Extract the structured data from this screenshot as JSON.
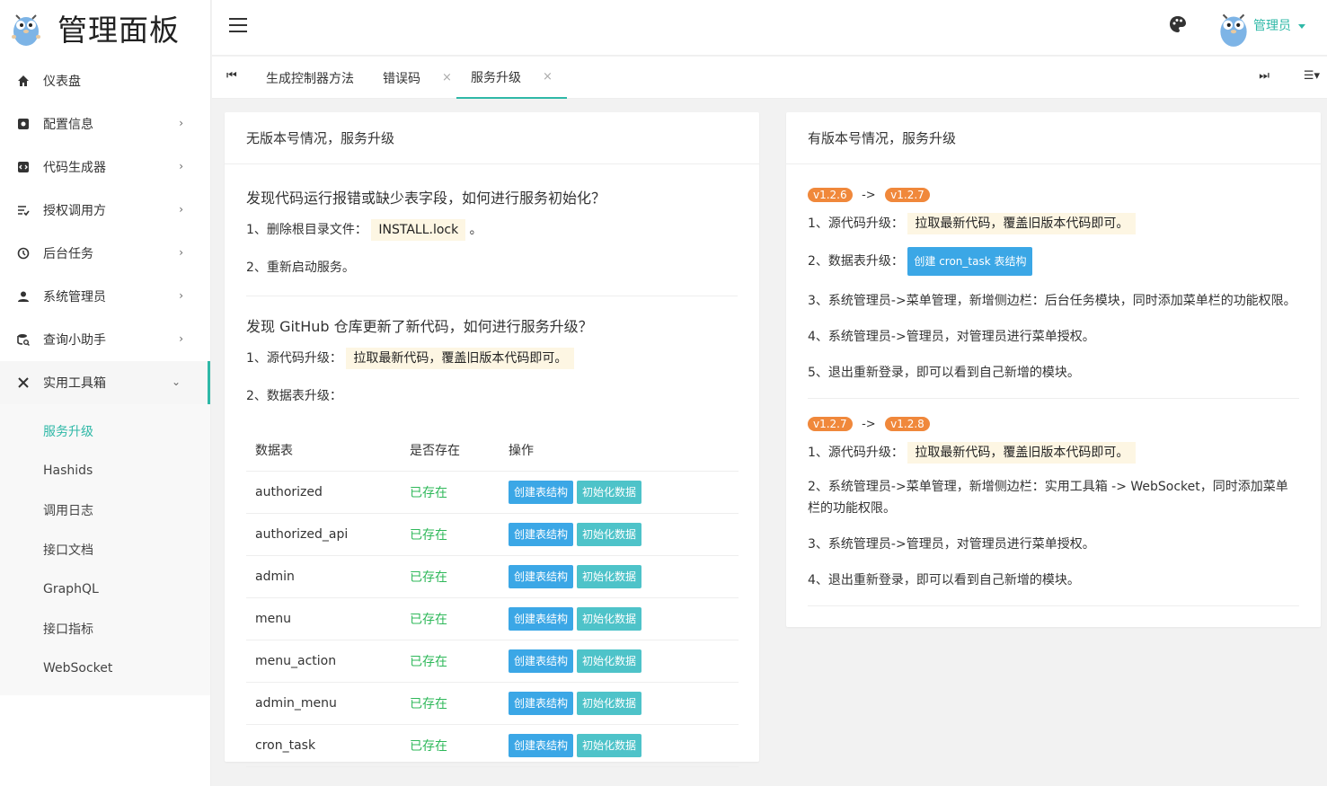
{
  "brand": {
    "title": "管理面板",
    "logo_icon": "gopher-logo-icon"
  },
  "sidebar": {
    "items": [
      {
        "label": "仪表盘",
        "icon": "home-icon"
      },
      {
        "label": "配置信息",
        "icon": "config-icon"
      },
      {
        "label": "代码生成器",
        "icon": "code-icon"
      },
      {
        "label": "授权调用方",
        "icon": "auth-icon"
      },
      {
        "label": "后台任务",
        "icon": "clock-icon"
      },
      {
        "label": "系统管理员",
        "icon": "user-icon"
      },
      {
        "label": "查询小助手",
        "icon": "database-search-icon"
      },
      {
        "label": "实用工具箱",
        "icon": "tools-icon"
      }
    ],
    "sub_items": [
      "服务升级",
      "Hashids",
      "调用日志",
      "接口文档",
      "GraphQL",
      "接口指标",
      "WebSocket"
    ]
  },
  "header": {
    "user": "管理员"
  },
  "tabs": {
    "items": [
      {
        "label": "生成控制器方法"
      },
      {
        "label": "错误码"
      },
      {
        "label": "服务升级"
      }
    ],
    "close": "×"
  },
  "left_card": {
    "title": "无版本号情况，服务升级",
    "q1": "发现代码运行报错或缺少表字段，如何进行服务初始化？",
    "q1_line1_prefix": "1、删除根目录文件：",
    "q1_line1_code": "INSTALL.lock",
    "q1_line1_suffix": "。",
    "q1_line2": "2、重新启动服务。",
    "q2": "发现 GitHub 仓库更新了新代码，如何进行服务升级？",
    "q2_line1_prefix": "1、源代码升级：",
    "q2_line1_hl": "拉取最新代码，覆盖旧版本代码即可。",
    "q2_line2": "2、数据表升级：",
    "table": {
      "headers": [
        "数据表",
        "是否存在",
        "操作"
      ],
      "rows": [
        {
          "name": "authorized",
          "status": "已存在"
        },
        {
          "name": "authorized_api",
          "status": "已存在"
        },
        {
          "name": "admin",
          "status": "已存在"
        },
        {
          "name": "menu",
          "status": "已存在"
        },
        {
          "name": "menu_action",
          "status": "已存在"
        },
        {
          "name": "admin_menu",
          "status": "已存在"
        },
        {
          "name": "cron_task",
          "status": "已存在"
        }
      ],
      "btn_create": "创建表结构",
      "btn_init": "初始化数据"
    }
  },
  "right_card": {
    "title": "有版本号情况，服务升级",
    "arrow": "->",
    "v1_from": "v1.2.6",
    "v1_to": "v1.2.7",
    "v1_l1_prefix": "1、源代码升级：",
    "v1_l1_hl": "拉取最新代码，覆盖旧版本代码即可。",
    "v1_l2_prefix": "2、数据表升级：",
    "v1_l2_btn": "创建 cron_task 表结构",
    "v1_l3": "3、系统管理员->菜单管理，新增侧边栏：后台任务模块，同时添加菜单栏的功能权限。",
    "v1_l4": "4、系统管理员->管理员，对管理员进行菜单授权。",
    "v1_l5": "5、退出重新登录，即可以看到自己新增的模块。",
    "v2_from": "v1.2.7",
    "v2_to": "v1.2.8",
    "v2_l1_prefix": "1、源代码升级：",
    "v2_l1_hl": "拉取最新代码，覆盖旧版本代码即可。",
    "v2_l2": "2、系统管理员->菜单管理，新增侧边栏：实用工具箱 -> WebSocket，同时添加菜单栏的功能权限。",
    "v2_l3": "3、系统管理员->管理员，对管理员进行菜单授权。",
    "v2_l4": "4、退出重新登录，即可以看到自己新增的模块。"
  },
  "colors": {
    "accent": "#2fb8a7",
    "tag": "#f0883b",
    "btn_blue": "#3ba7e6",
    "btn_teal": "#4ec3c9",
    "ok": "#2fb85a"
  }
}
